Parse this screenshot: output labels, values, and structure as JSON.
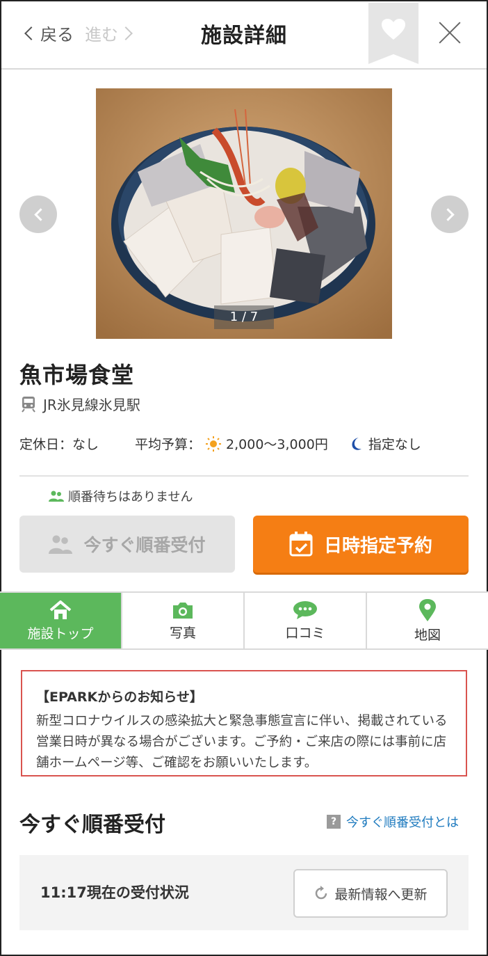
{
  "header": {
    "back_label": "戻る",
    "forward_label": "進む",
    "title": "施設詳細"
  },
  "gallery": {
    "counter": "1 / 7",
    "current": 1,
    "total": 7
  },
  "store": {
    "name": "魚市場食堂",
    "station": "JR氷見線氷見駅",
    "holiday": "定休日：なし",
    "budget_label": "平均予算：",
    "lunch_budget": "2,000〜3,000円",
    "dinner_budget": "指定なし"
  },
  "queue_note": "順番待ちはありません",
  "actions": {
    "queue_label": "今すぐ順番受付",
    "reserve_label": "日時指定予約"
  },
  "tabs": [
    {
      "label": "施設トップ",
      "icon": "home-icon",
      "active": true
    },
    {
      "label": "写真",
      "icon": "camera-icon",
      "active": false
    },
    {
      "label": "口コミ",
      "icon": "chat-bubble-icon",
      "active": false
    },
    {
      "label": "地図",
      "icon": "map-pin-icon",
      "active": false
    }
  ],
  "notice": {
    "title": "【EPARKからのお知らせ】",
    "body": "新型コロナウイルスの感染拡大と緊急事態宣言に伴い、掲載されている営業日時が異なる場合がございます。ご予約・ご来店の際には事前に店舗ホームページ等、ご確認をお願いいたします。"
  },
  "queue_section": {
    "title": "今すぐ順番受付",
    "help_link": "今すぐ順番受付とは",
    "status": "11:17現在の受付状況",
    "refresh_label": "最新情報へ更新"
  },
  "colors": {
    "accent_orange": "#f57e14",
    "tab_active_green": "#5cb85c",
    "notice_border": "#d9534f",
    "link_blue": "#1f7bbf"
  }
}
